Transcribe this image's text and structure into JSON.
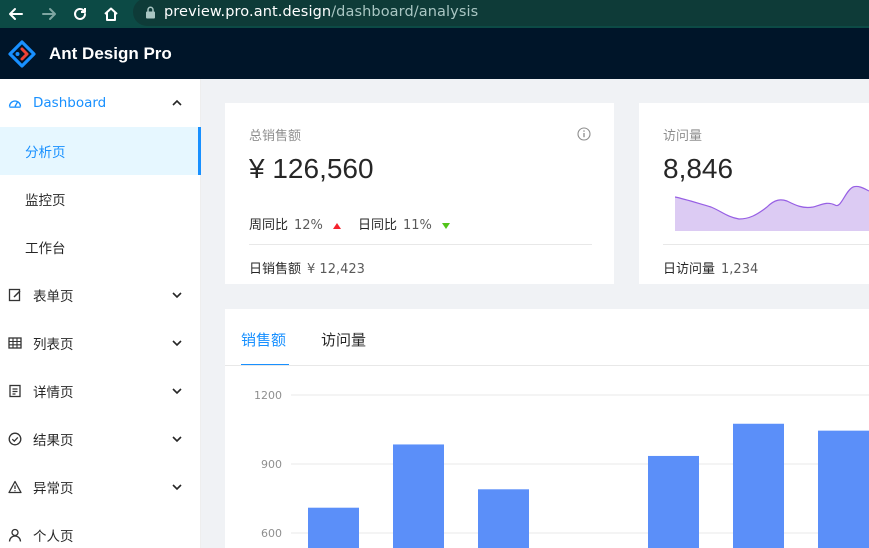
{
  "browser": {
    "url_host": "preview.pro.ant.design",
    "url_path": "/dashboard/analysis"
  },
  "header": {
    "title": "Ant Design Pro"
  },
  "sidebar": {
    "items": [
      {
        "label": "Dashboard",
        "icon": "dashboard-icon",
        "state": "open"
      },
      {
        "label": "分析页",
        "state": "active"
      },
      {
        "label": "监控页"
      },
      {
        "label": "工作台"
      },
      {
        "label": "表单页",
        "icon": "form-icon"
      },
      {
        "label": "列表页",
        "icon": "table-icon"
      },
      {
        "label": "详情页",
        "icon": "profile-icon"
      },
      {
        "label": "结果页",
        "icon": "check-circle-icon"
      },
      {
        "label": "异常页",
        "icon": "warning-icon"
      },
      {
        "label": "个人页",
        "icon": "user-icon"
      }
    ]
  },
  "cards": {
    "sales": {
      "label": "总销售额",
      "value": "¥ 126,560",
      "week_label": "周同比",
      "week_value": "12%",
      "day_label": "日同比",
      "day_value": "11%",
      "footer_label": "日销售额",
      "footer_value": "¥ 12,423"
    },
    "visits": {
      "label": "访问量",
      "value": "8,846",
      "footer_label": "日访问量",
      "footer_value": "1,234"
    }
  },
  "tabs": [
    {
      "label": "销售额",
      "active": true
    },
    {
      "label": "访问量",
      "active": false
    }
  ],
  "colors": {
    "primary": "#1890ff",
    "bar": "#5b8ff9",
    "area_fill": "#dccbf3",
    "area_line": "#975fe4",
    "up": "#f5222d",
    "down": "#52c41a"
  },
  "chart_data": {
    "type": "bar",
    "y_ticks": [
      1200,
      900,
      600
    ],
    "bars": [
      {
        "index": 0,
        "value": 710
      },
      {
        "index": 1,
        "value": 985
      },
      {
        "index": 2,
        "value": 790
      },
      {
        "index": 4,
        "value": 935
      },
      {
        "index": 5,
        "value": 1075
      },
      {
        "index": 6,
        "value": 1045
      }
    ]
  }
}
